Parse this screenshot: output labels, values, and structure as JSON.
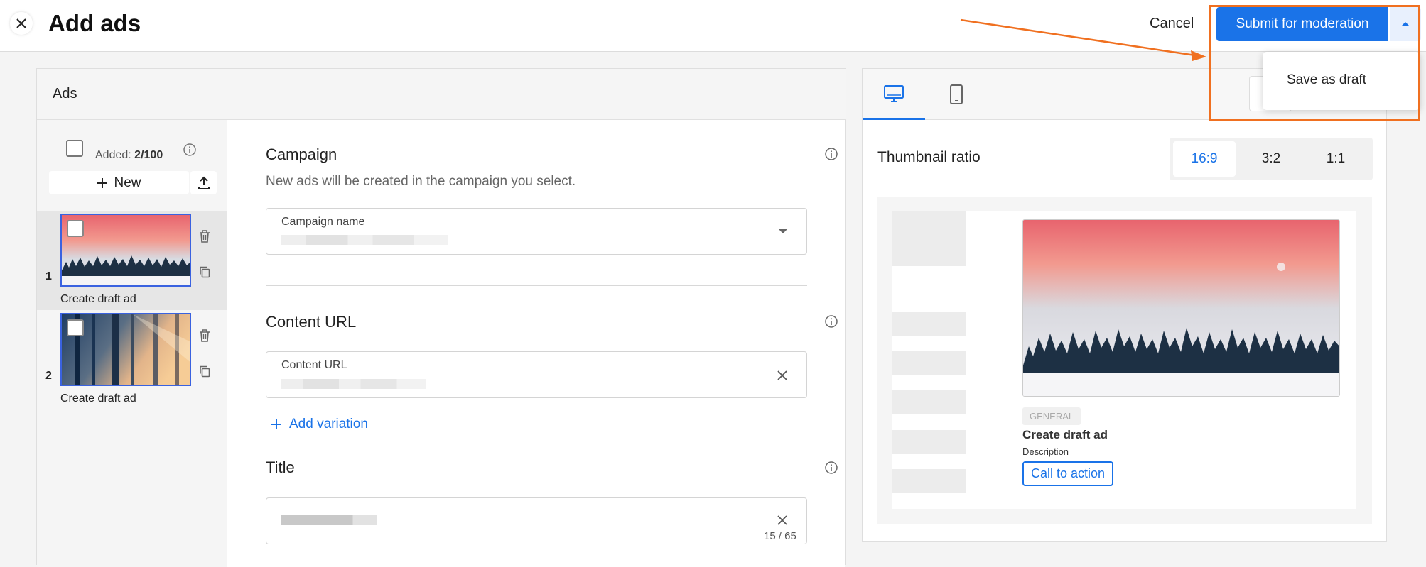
{
  "header": {
    "title": "Add ads",
    "cancel_label": "Cancel",
    "submit_label": "Submit for moderation",
    "menu_item": "Save as draft"
  },
  "ads": {
    "panel_title": "Ads",
    "added_label": "Added:",
    "added_count": "2/100",
    "new_label": "New",
    "items": [
      {
        "index": "1",
        "label": "Create draft ad",
        "selected": true
      },
      {
        "index": "2",
        "label": "Create draft ad",
        "selected": false
      }
    ]
  },
  "form": {
    "campaign": {
      "title": "Campaign",
      "subtitle": "New ads will be created in the campaign you select.",
      "field_label": "Campaign name"
    },
    "content_url": {
      "title": "Content URL",
      "field_label": "Content URL",
      "add_variation": "Add variation"
    },
    "title": {
      "title": "Title",
      "counter": "15 / 65"
    }
  },
  "preview": {
    "ratio_label": "Thumbnail ratio",
    "ratios": [
      "16:9",
      "3:2",
      "1:1"
    ],
    "selected_ratio": "16:9",
    "badge": "GENERAL",
    "ad_title": "Create draft ad",
    "description": "Description",
    "cta": "Call to action"
  },
  "colors": {
    "accent": "#1a73e8",
    "highlight": "#f07020"
  },
  "icons": {
    "close": "close-icon",
    "dropdown": "caret-up-icon",
    "info": "info-icon",
    "upload": "upload-icon",
    "delete": "trash-icon",
    "copy": "copy-icon",
    "desktop": "desktop-icon",
    "mobile": "mobile-icon",
    "clear": "clear-icon"
  }
}
